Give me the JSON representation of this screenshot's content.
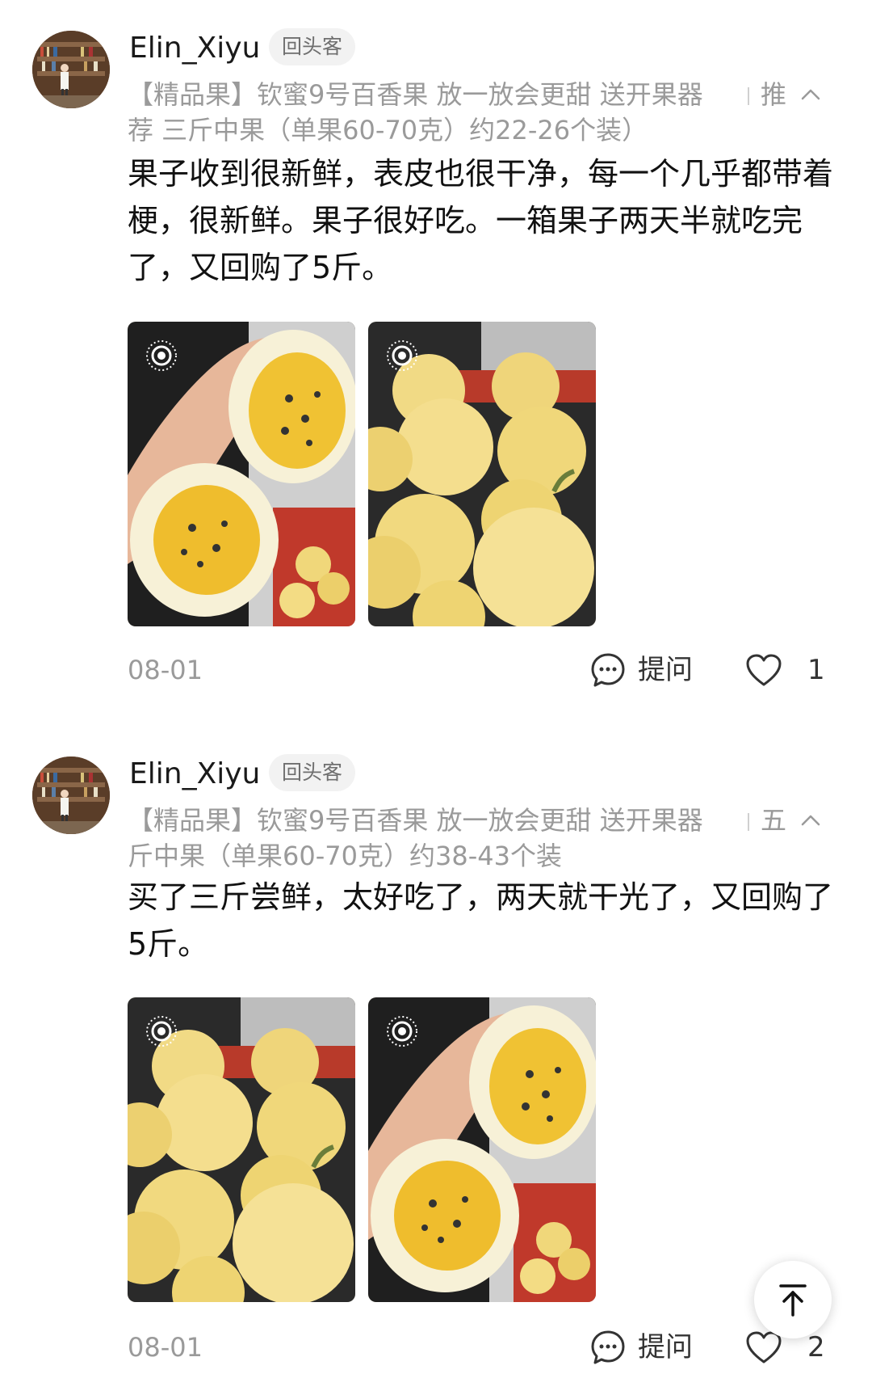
{
  "reviews": [
    {
      "username": "Elin_Xiyu",
      "badge": "回头客",
      "sku_line1": "【精品果】钦蜜9号百香果 放一放会更甜 送开果器",
      "sku_tail": "推",
      "sku_line2": "荐 三斤中果（单果60-70克）约22-26个装）",
      "content": "果子收到很新鲜，表皮也很干净，每一个几乎都带着梗，很新鲜。果子很好吃。一箱果子两天半就吃完了，又回购了5斤。",
      "date": "08-01",
      "ask_label": "提问",
      "like_count": "1"
    },
    {
      "username": "Elin_Xiyu",
      "badge": "回头客",
      "sku_line1": "【精品果】钦蜜9号百香果 放一放会更甜 送开果器",
      "sku_tail": "五",
      "sku_line2": "斤中果（单果60-70克）约38-43个装",
      "content": "买了三斤尝鲜，太好吃了，两天就干光了，又回购了5斤。",
      "date": "08-01",
      "ask_label": "提问",
      "like_count": "2"
    }
  ],
  "icons": {
    "live_photo": "live-photo-icon",
    "ask": "chat-bubble-icon",
    "like": "heart-icon",
    "collapse": "chevron-up-icon",
    "back_to_top": "arrow-up-to-top-icon"
  },
  "colors": {
    "text_primary": "#111111",
    "text_secondary": "#9a9a9a",
    "badge_bg": "#f2f2f2",
    "fruit_yellow": "#f0d77a"
  }
}
